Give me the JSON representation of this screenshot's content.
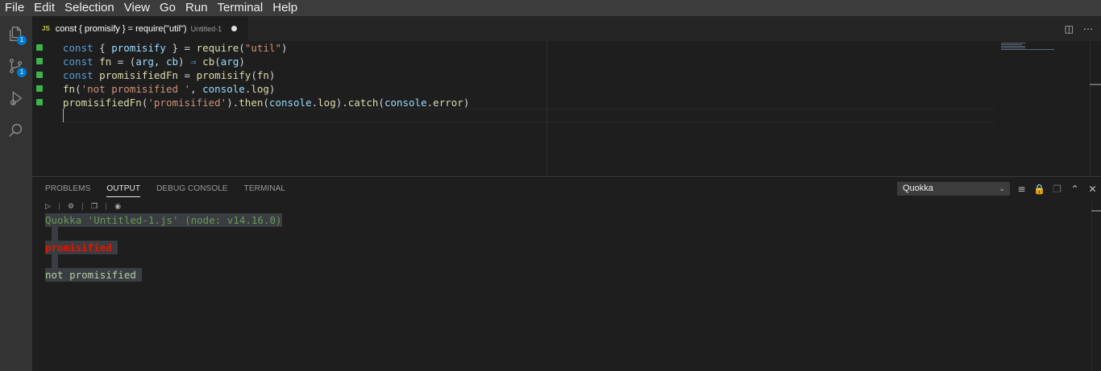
{
  "menu": [
    "File",
    "Edit",
    "Selection",
    "View",
    "Go",
    "Run",
    "Terminal",
    "Help"
  ],
  "activity_bar": {
    "explorer_badge": "1",
    "source_control_badge": "1"
  },
  "tab": {
    "icon_text": "JS",
    "title": "const { promisify } = require(\"util\")",
    "description": "Untitled-1"
  },
  "tab_actions": {
    "split_icon": "split-editor-icon",
    "more_icon": "more-actions-icon"
  },
  "editor": {
    "lines": [
      "const { promisify } = require(\"util\")",
      "const fn = (arg, cb) ⇒ cb(arg)",
      "const promisifiedFn = promisify(fn)",
      "fn('not promisified ', console.log)",
      "promisifiedFn('promisified').then(console.log).catch(console.error)"
    ]
  },
  "panel": {
    "tabs": [
      "PROBLEMS",
      "OUTPUT",
      "DEBUG CONSOLE",
      "TERMINAL"
    ],
    "active_tab": "OUTPUT",
    "output_channel": "Quokka",
    "output": {
      "header": "Quokka 'Untitled-1.js' (node: v14.16.0)",
      "line1": "promisified ",
      "line2": "not promisified "
    }
  },
  "colors": {
    "accent": "#007acc",
    "gutter_added": "#3bb54a",
    "quokka_header": "#6a9955",
    "promisified_text": "#e51400",
    "output_text": "#b5cea8"
  }
}
